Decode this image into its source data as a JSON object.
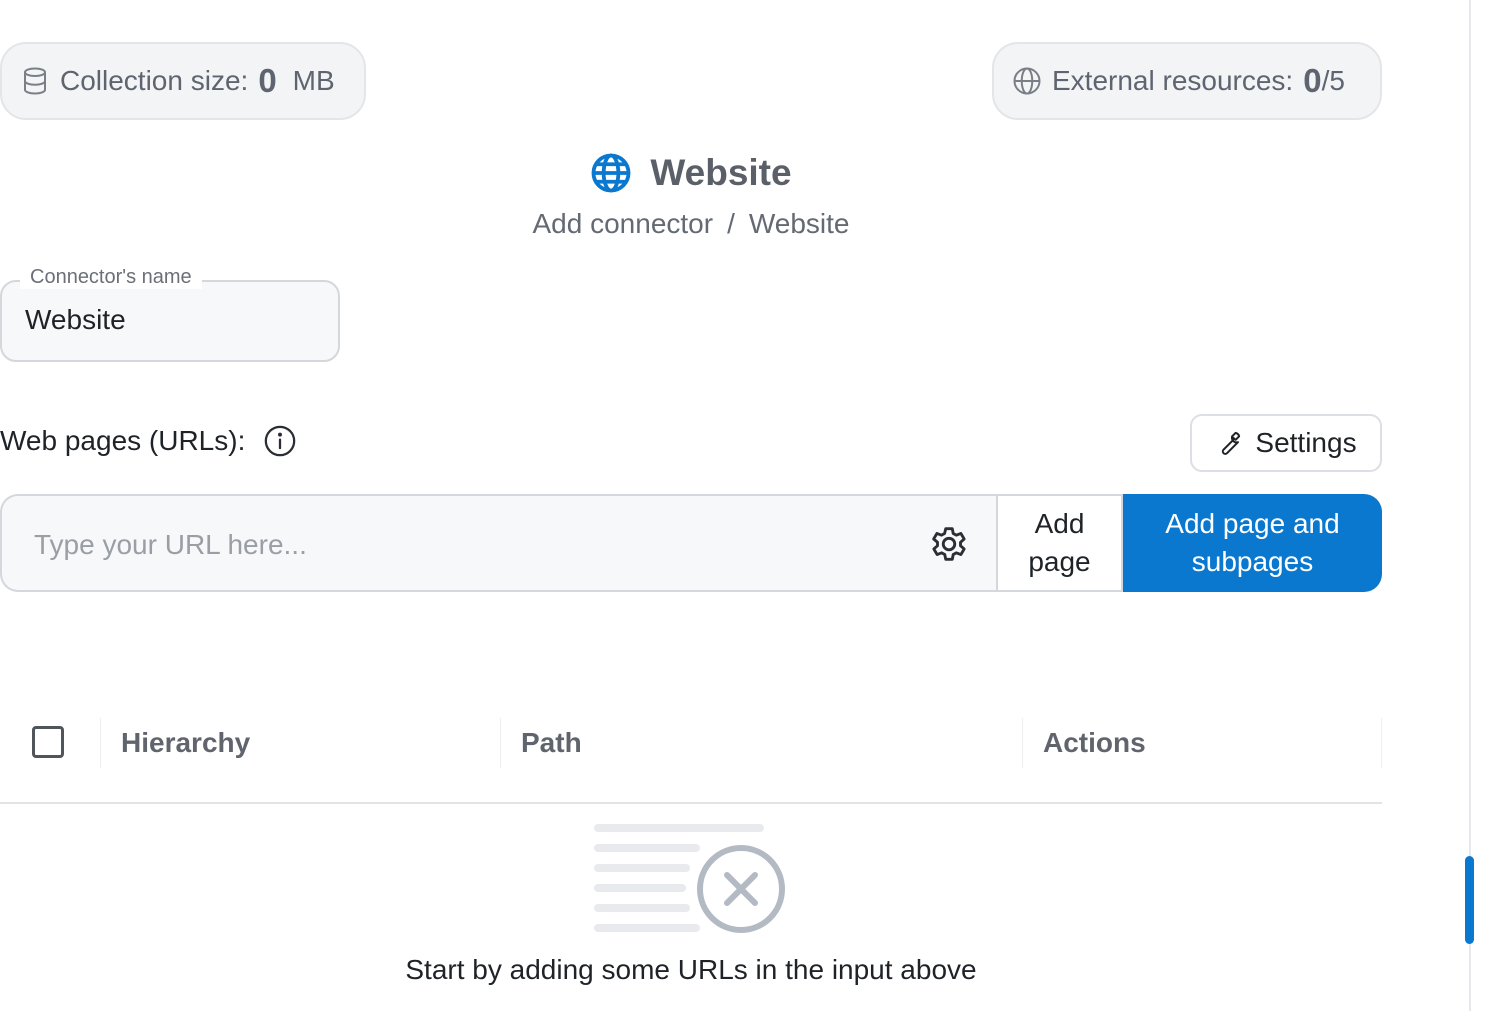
{
  "stats": {
    "collection_label": "Collection size:",
    "collection_value": "0",
    "collection_unit": "MB",
    "external_label": "External resources:",
    "external_value": "0",
    "external_total": "/5"
  },
  "header": {
    "title": "Website",
    "breadcrumb": [
      "Add connector",
      "/",
      "Website"
    ],
    "icon": "globe-icon"
  },
  "connector": {
    "name_label": "Connector's name",
    "name_value": "Website"
  },
  "web_pages": {
    "label": "Web pages (URLs):",
    "settings_label": "Settings",
    "url_placeholder": "Type your URL here...",
    "add_page_lines": [
      "Add",
      "page"
    ],
    "add_subpages_lines": [
      "Add page and",
      "subpages"
    ]
  },
  "table": {
    "columns": [
      "Hierarchy",
      "Path",
      "Actions"
    ]
  },
  "empty_state": {
    "message": "Start by adding some URLs in the input above",
    "icon": "empty-list-icon"
  },
  "colors": {
    "accent": "#0b78d0",
    "pill_bg": "#f3f4f6",
    "muted_text": "#5f6570"
  }
}
